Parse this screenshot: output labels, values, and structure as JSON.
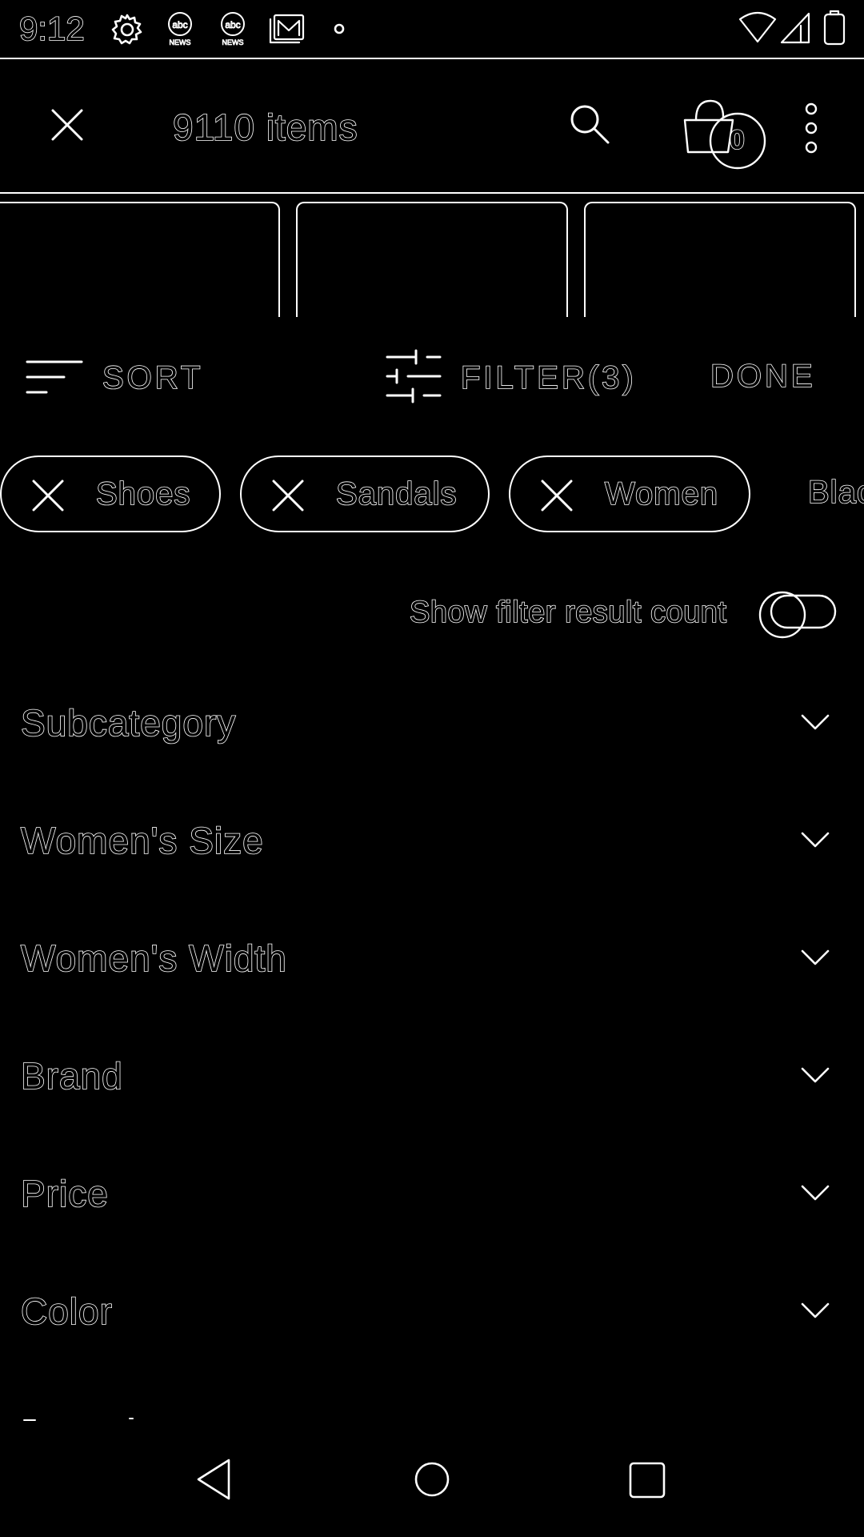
{
  "status_bar": {
    "time": "9:12",
    "icons": [
      "settings-icon",
      "abc-news-icon",
      "abc-news-icon",
      "gallery-icon",
      "dot-icon"
    ],
    "right_icons": [
      "wifi-icon",
      "cell-signal-icon",
      "battery-icon"
    ]
  },
  "toolbar": {
    "title": "9110 items",
    "cart_count": "0"
  },
  "actions": {
    "sort_label": "SORT",
    "filter_label": "FILTER(3)",
    "done_label": "DONE"
  },
  "chips": [
    {
      "label": "Shoes"
    },
    {
      "label": "Sandals"
    },
    {
      "label": "Women"
    },
    {
      "label": "Blac"
    }
  ],
  "toggle": {
    "label": "Show filter result count",
    "state": "off"
  },
  "filters": [
    {
      "label": "Subcategory"
    },
    {
      "label": "Women's Size"
    },
    {
      "label": "Women's Width"
    },
    {
      "label": "Brand"
    },
    {
      "label": "Price"
    },
    {
      "label": "Color"
    }
  ],
  "colors": {
    "background": "#000000",
    "foreground": "#ffffff"
  }
}
